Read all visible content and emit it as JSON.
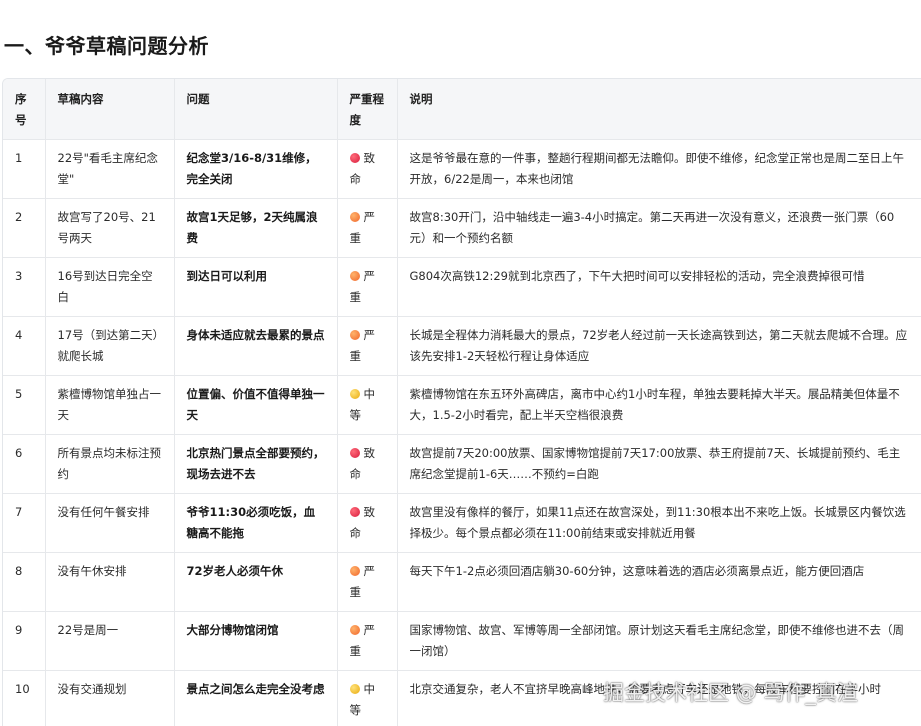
{
  "heading": "一、爷爷草稿问题分析",
  "columns": [
    "序号",
    "草稿内容",
    "问题",
    "严重程度",
    "说明"
  ],
  "rows": [
    {
      "no": "1",
      "content": "22号\"看毛主席纪念堂\"",
      "problem": "纪念堂3/16-8/31维修，完全关闭",
      "severity": "致命",
      "severity_level": "red",
      "note": "这是爷爷最在意的一件事，整趟行程期间都无法瞻仰。即使不维修，纪念堂正常也是周二至日上午开放，6/22是周一，本来也闭馆"
    },
    {
      "no": "2",
      "content": "故宫写了20号、21号两天",
      "problem": "故宫1天足够，2天纯属浪费",
      "severity": "严重",
      "severity_level": "orange",
      "note": "故宫8:30开门，沿中轴线走一遍3-4小时搞定。第二天再进一次没有意义，还浪费一张门票（60元）和一个预约名额"
    },
    {
      "no": "3",
      "content": "16号到达日完全空白",
      "problem": "到达日可以利用",
      "severity": "严重",
      "severity_level": "orange",
      "note": "G804次高铁12:29就到北京西了，下午大把时间可以安排轻松的活动，完全浪费掉很可惜"
    },
    {
      "no": "4",
      "content": "17号（到达第二天）就爬长城",
      "problem": "身体未适应就去最累的景点",
      "severity": "严重",
      "severity_level": "orange",
      "note": "长城是全程体力消耗最大的景点，72岁老人经过前一天长途高铁到达，第二天就去爬城不合理。应该先安排1-2天轻松行程让身体适应"
    },
    {
      "no": "5",
      "content": "紫檀博物馆单独占一天",
      "problem": "位置偏、价值不值得单独一天",
      "severity": "中等",
      "severity_level": "yellow",
      "note": "紫檀博物馆在东五环外高碑店，离市中心约1小时车程，单独去要耗掉大半天。展品精美但体量不大，1.5-2小时看完，配上半天空档很浪费"
    },
    {
      "no": "6",
      "content": "所有景点均未标注预约",
      "problem": "北京热门景点全部要预约，现场去进不去",
      "severity": "致命",
      "severity_level": "red",
      "note": "故宫提前7天20:00放票、国家博物馆提前7天17:00放票、恭王府提前7天、长城提前预约、毛主席纪念堂提前1-6天……不预约=白跑"
    },
    {
      "no": "7",
      "content": "没有任何午餐安排",
      "problem": "爷爷11:30必须吃饭，血糖高不能拖",
      "severity": "致命",
      "severity_level": "red",
      "note": "故宫里没有像样的餐厅，如果11点还在故宫深处，到11:30根本出不来吃上饭。长城景区内餐饮选择极少。每个景点都必须在11:00前结束或安排就近用餐"
    },
    {
      "no": "8",
      "content": "没有午休安排",
      "problem": "72岁老人必须午休",
      "severity": "严重",
      "severity_level": "orange",
      "note": "每天下午1-2点必须回酒店躺30-60分钟，这意味着选的酒店必须离景点近，能方便回酒店"
    },
    {
      "no": "9",
      "content": "22号是周一",
      "problem": "大部分博物馆闭馆",
      "severity": "严重",
      "severity_level": "orange",
      "note": "国家博物馆、故宫、军博等周一全部闭馆。原计划这天看毛主席纪念堂，即使不维修也进不去（周一闭馆）"
    },
    {
      "no": "10",
      "content": "没有交通规划",
      "problem": "景点之间怎么走完全没考虑",
      "severity": "中等",
      "severity_level": "yellow",
      "note": "北京交通复杂，老人不宜挤早晚高峰地铁，需要考虑打车还是地铁，每段车程要控制在半小时"
    }
  ],
  "watermark": "掘金技术社区 @ 骂作_真渲"
}
